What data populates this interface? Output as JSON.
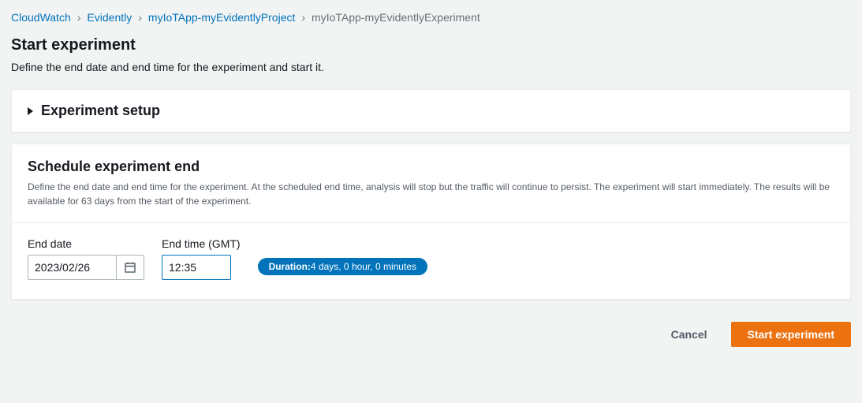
{
  "breadcrumb": {
    "items": [
      {
        "label": "CloudWatch"
      },
      {
        "label": "Evidently"
      },
      {
        "label": "myIoTApp-myEvidentlyProject"
      }
    ],
    "current": "myIoTApp-myEvidentlyExperiment"
  },
  "page": {
    "title": "Start experiment",
    "description": "Define the end date and end time for the experiment and start it."
  },
  "setupPanel": {
    "title": "Experiment setup"
  },
  "schedulePanel": {
    "title": "Schedule experiment end",
    "description": "Define the end date and end time for the experiment. At the scheduled end time, analysis will stop but the traffic will continue to persist. The experiment will start immediately. The results will be available for 63 days from the start of the experiment.",
    "endDateLabel": "End date",
    "endDateValue": "2023/02/26",
    "endTimeLabel": "End time (GMT)",
    "endTimeValue": "12:35",
    "durationLabel": "Duration:",
    "durationValue": "4 days, 0 hour, 0 minutes"
  },
  "footer": {
    "cancel": "Cancel",
    "start": "Start experiment"
  }
}
